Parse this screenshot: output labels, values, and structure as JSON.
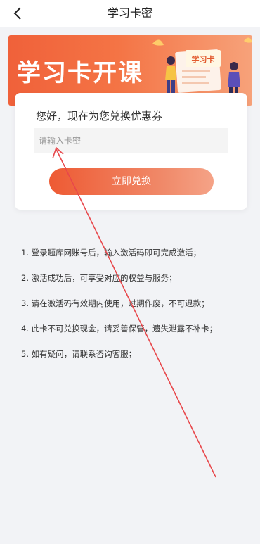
{
  "header": {
    "title": "学习卡密",
    "back_icon": "chevron-left-icon"
  },
  "banner": {
    "title": "学习卡开课",
    "sign_text": "学习卡"
  },
  "card": {
    "title": "您好，现在为您兑换优惠券",
    "input_placeholder": "请输入卡密",
    "input_value": "",
    "button_label": "立即兑换"
  },
  "rules": [
    "1. 登录题库网账号后，输入激活码即可完成激活；",
    "2. 激活成功后，可享受对应的权益与服务；",
    "3. 请在激活码有效期内使用，过期作废，不可退款；",
    "4. 此卡不可兑换现金，请妥善保管，遗失泄露不补卡；",
    "5. 如有疑问，请联系咨询客服；"
  ],
  "colors": {
    "accent": "#ee5a33",
    "background": "#f2f3f6",
    "annotation": "#e8474b"
  }
}
